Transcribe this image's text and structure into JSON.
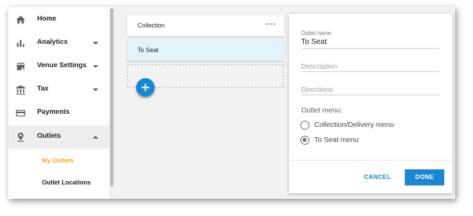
{
  "sidebar": {
    "items": [
      {
        "label": "Home",
        "icon": "home-icon",
        "has_caret": false
      },
      {
        "label": "Analytics",
        "icon": "bar-chart-icon",
        "has_caret": true,
        "caret": "down"
      },
      {
        "label": "Venue Settings",
        "icon": "storefront-icon",
        "has_caret": true,
        "caret": "down"
      },
      {
        "label": "Tax",
        "icon": "bank-icon",
        "has_caret": true,
        "caret": "down"
      },
      {
        "label": "Payments",
        "icon": "credit-card-icon",
        "has_caret": false
      },
      {
        "label": "Outlets",
        "icon": "location-pin-icon",
        "has_caret": true,
        "caret": "up",
        "active": true
      }
    ],
    "sub_items": [
      {
        "label": "My Outlets",
        "active": true
      },
      {
        "label": "Outlet Locations",
        "active": false
      }
    ]
  },
  "outlet_list": {
    "cards": [
      {
        "label": "Collection",
        "selected": false,
        "more_icon": "more-horizontal-icon"
      },
      {
        "label": "To Seat",
        "selected": true
      }
    ],
    "add_button_icon": "plus-icon"
  },
  "edit_panel": {
    "outlet_name_label": "Outlet name",
    "outlet_name_value": "To Seat",
    "description_placeholder": "Description",
    "directions_placeholder": "Directions",
    "outlet_menu_label": "Outlet menu:",
    "menu_options": [
      {
        "label": "Collection/Delivery menu",
        "checked": false
      },
      {
        "label": "To Seat menu",
        "checked": true
      }
    ],
    "cancel_label": "CANCEL",
    "done_label": "DONE"
  },
  "colors": {
    "accent": "#1a87d0",
    "active_subitem": "#f5a623",
    "selected_card": "#e1f4fb"
  }
}
